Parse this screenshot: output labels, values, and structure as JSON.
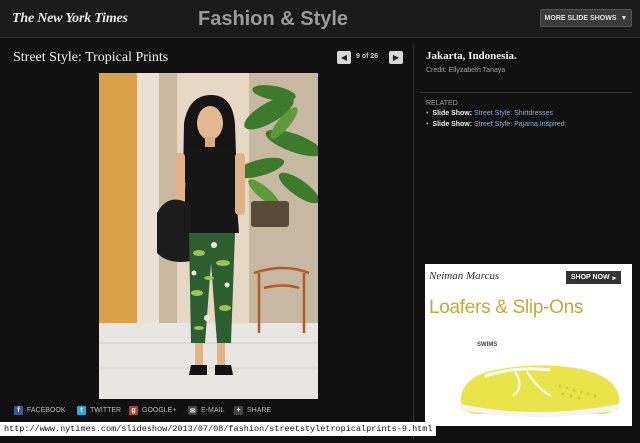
{
  "header": {
    "logo": "The New York Times",
    "section": "Fashion & Style",
    "more_label": "MORE SLIDE SHOWS"
  },
  "slideshow": {
    "title": "Street Style: Tropical Prints",
    "counter": "9 of 26"
  },
  "caption": {
    "location": "Jakarta, Indonesia.",
    "credit": "Credit: Ellyzabeth Tanaya"
  },
  "related": {
    "heading": "RELATED",
    "items": [
      {
        "kind": "Slide Show:",
        "title": "Street Style: Shirtdresses"
      },
      {
        "kind": "Slide Show:",
        "title": "Street Style: Pajama Inspired"
      }
    ]
  },
  "share": {
    "facebook": "FACEBOOK",
    "twitter": "TWITTER",
    "google": "GOOGLE+",
    "email": "E-MAIL",
    "share": "SHARE"
  },
  "ad": {
    "brand": "Neiman Marcus",
    "shop_label": "SHOP NOW",
    "headline": "Loafers & Slip-Ons",
    "product_brand": "SWIMS"
  },
  "status_url": "http://www.nytimes.com/slideshow/2013/07/08/fashion/streetstyletropicalprints-9.html",
  "colors": {
    "background": "#111111",
    "link": "#7fb2e6",
    "ad_headline": "#c9a63a"
  }
}
